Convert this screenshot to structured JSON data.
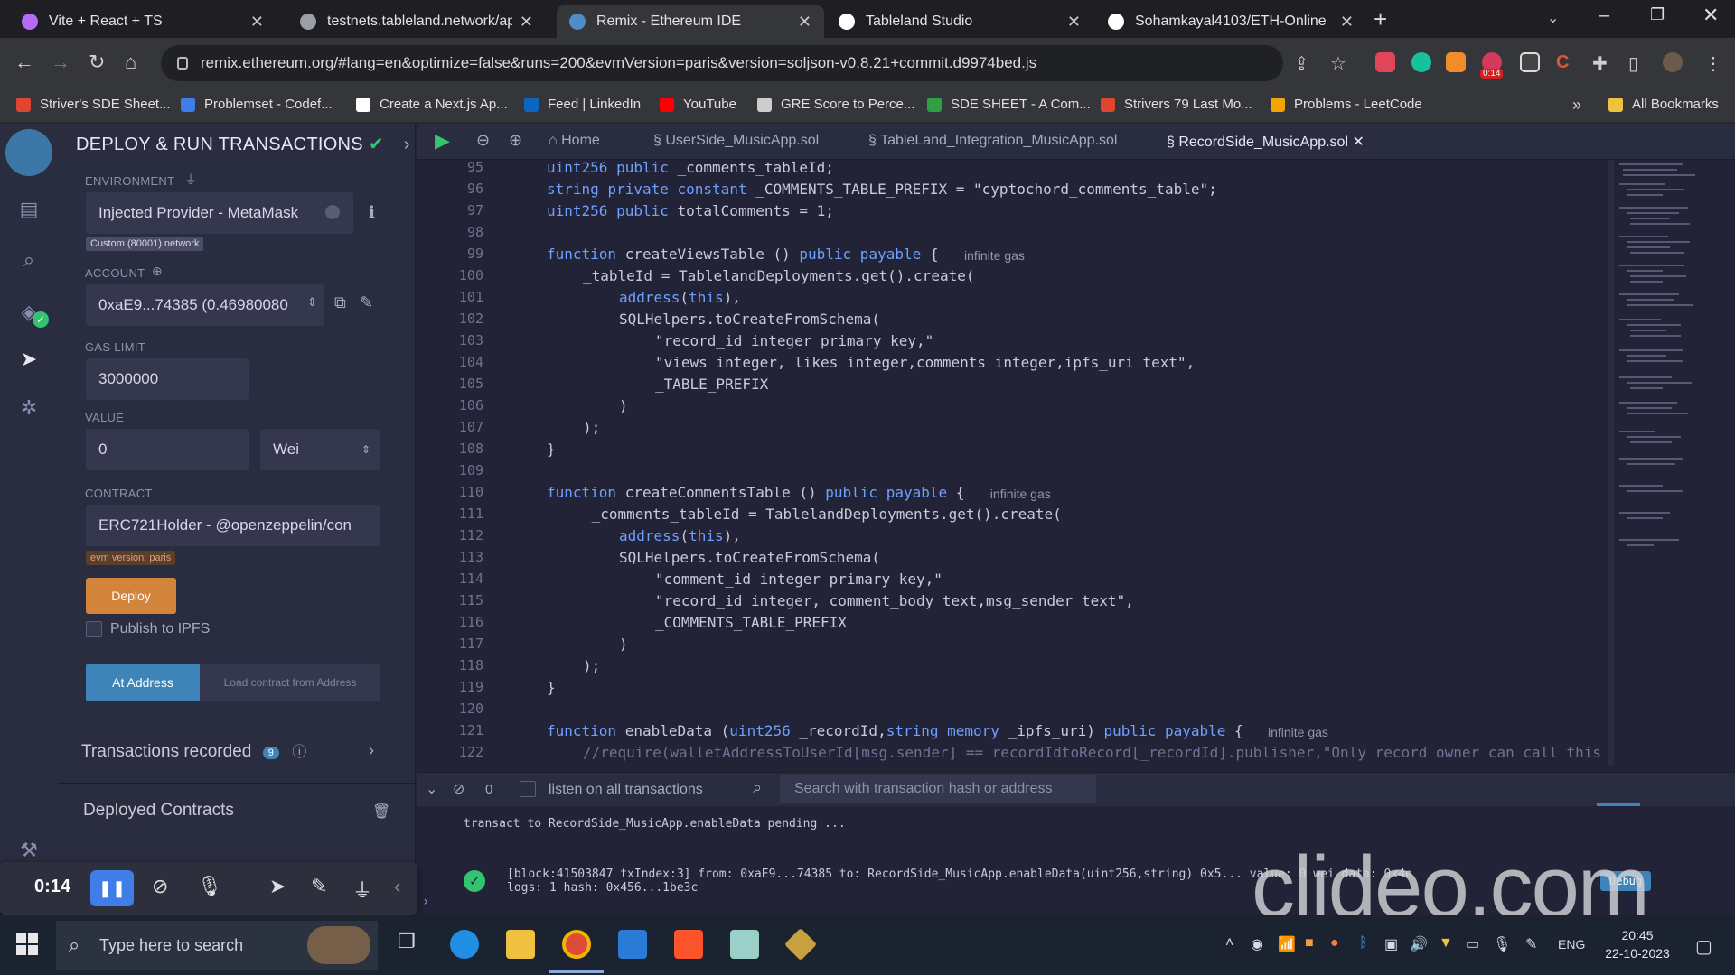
{
  "browser": {
    "tabs": [
      {
        "title": "Vite + React + TS",
        "active": false,
        "icon": "vite-icon",
        "color": "#b46cf7"
      },
      {
        "title": "testnets.tableland.network/api/v",
        "active": false,
        "icon": "globe-icon",
        "color": "#9aa0a6"
      },
      {
        "title": "Remix - Ethereum IDE",
        "active": true,
        "icon": "remix-icon",
        "color": "#4d8ec7"
      },
      {
        "title": "Tableland Studio",
        "active": false,
        "icon": "tableland-icon",
        "color": "#ffffff"
      },
      {
        "title": "Sohamkayal4103/ETH-Online",
        "active": false,
        "icon": "github-icon",
        "color": "#ffffff"
      }
    ],
    "new_tab": "+",
    "url": "remix.ethereum.org/#lang=en&optimize=false&runs=200&evmVersion=paris&version=soljson-v0.8.21+commit.d9974bed.js",
    "ext_badge": "0:14",
    "bookmarks": [
      {
        "label": "Striver's SDE Sheet...",
        "color": "#e0452f"
      },
      {
        "label": "Problemset - Codef...",
        "color": "#3f7ee8"
      },
      {
        "label": "Create a Next.js Ap...",
        "color": "#ffffff"
      },
      {
        "label": "Feed | LinkedIn",
        "color": "#0a66c2"
      },
      {
        "label": "YouTube",
        "color": "#ff0000"
      },
      {
        "label": "GRE Score to Perce...",
        "color": "#cccccc"
      },
      {
        "label": "SDE SHEET - A Com...",
        "color": "#2ea043"
      },
      {
        "label": "Strivers 79 Last Mo...",
        "color": "#e0452f"
      },
      {
        "label": "Problems - LeetCode",
        "color": "#f0a500"
      }
    ],
    "all_bookmarks": "All Bookmarks",
    "more": "»"
  },
  "remix": {
    "panel_title": "DEPLOY & RUN TRANSACTIONS",
    "environment_label": "ENVIRONMENT",
    "environment_value": "Injected Provider - MetaMask",
    "network_badge": "Custom (80001) network",
    "account_label": "ACCOUNT",
    "account_value": "0xaE9...74385 (0.46980080",
    "gas_limit_label": "GAS LIMIT",
    "gas_limit_value": "3000000",
    "value_label": "VALUE",
    "value_value": "0",
    "value_unit": "Wei",
    "contract_label": "CONTRACT",
    "contract_value": "ERC721Holder - @openzeppelin/con",
    "evm_badge": "evm version: paris",
    "deploy_button": "Deploy",
    "publish_ipfs": "Publish to IPFS",
    "at_address_button": "At Address",
    "load_contract": "Load contract from Address",
    "transactions_recorded": "Transactions recorded",
    "transactions_count": "9",
    "deployed_contracts": "Deployed Contracts"
  },
  "editor": {
    "tabs": [
      {
        "label": "Home",
        "active": false
      },
      {
        "label": "UserSide_MusicApp.sol",
        "active": false
      },
      {
        "label": "TableLand_Integration_MusicApp.sol",
        "active": false
      },
      {
        "label": "RecordSide_MusicApp.sol",
        "active": true
      }
    ],
    "lines": [
      {
        "n": "95",
        "indent": 0,
        "text": "uint256 public _comments_tableId;",
        "hint": ""
      },
      {
        "n": "96",
        "indent": 0,
        "text": "string private constant _COMMENTS_TABLE_PREFIX = \"cyptochord_comments_table\";",
        "hint": ""
      },
      {
        "n": "97",
        "indent": 0,
        "text": "uint256 public totalComments = 1;",
        "hint": ""
      },
      {
        "n": "98",
        "indent": 0,
        "text": "",
        "hint": ""
      },
      {
        "n": "99",
        "indent": 0,
        "text": "function createViewsTable () public payable {",
        "hint": "infinite gas"
      },
      {
        "n": "100",
        "indent": 1,
        "text": "_tableId = TablelandDeployments.get().create(",
        "hint": ""
      },
      {
        "n": "101",
        "indent": 2,
        "text": "address(this),",
        "hint": ""
      },
      {
        "n": "102",
        "indent": 2,
        "text": "SQLHelpers.toCreateFromSchema(",
        "hint": ""
      },
      {
        "n": "103",
        "indent": 3,
        "text": "\"record_id integer primary key,\"",
        "hint": ""
      },
      {
        "n": "104",
        "indent": 3,
        "text": "\"views integer, likes integer,comments integer,ipfs_uri text\",",
        "hint": ""
      },
      {
        "n": "105",
        "indent": 3,
        "text": "_TABLE_PREFIX",
        "hint": ""
      },
      {
        "n": "106",
        "indent": 2,
        "text": ")",
        "hint": ""
      },
      {
        "n": "107",
        "indent": 1,
        "text": ");",
        "hint": ""
      },
      {
        "n": "108",
        "indent": 0,
        "text": "}",
        "hint": ""
      },
      {
        "n": "109",
        "indent": 0,
        "text": "",
        "hint": ""
      },
      {
        "n": "110",
        "indent": 0,
        "text": "function createCommentsTable () public payable {",
        "hint": "infinite gas"
      },
      {
        "n": "111",
        "indent": 1,
        "text": " _comments_tableId = TablelandDeployments.get().create(",
        "hint": ""
      },
      {
        "n": "112",
        "indent": 2,
        "text": "address(this),",
        "hint": ""
      },
      {
        "n": "113",
        "indent": 2,
        "text": "SQLHelpers.toCreateFromSchema(",
        "hint": ""
      },
      {
        "n": "114",
        "indent": 3,
        "text": "\"comment_id integer primary key,\"",
        "hint": ""
      },
      {
        "n": "115",
        "indent": 3,
        "text": "\"record_id integer, comment_body text,msg_sender text\",",
        "hint": ""
      },
      {
        "n": "116",
        "indent": 3,
        "text": "_COMMENTS_TABLE_PREFIX",
        "hint": ""
      },
      {
        "n": "117",
        "indent": 2,
        "text": ")",
        "hint": ""
      },
      {
        "n": "118",
        "indent": 1,
        "text": ");",
        "hint": ""
      },
      {
        "n": "119",
        "indent": 0,
        "text": "}",
        "hint": ""
      },
      {
        "n": "120",
        "indent": 0,
        "text": "",
        "hint": ""
      },
      {
        "n": "121",
        "indent": 0,
        "text": "function enableData (uint256 _recordId,string memory _ipfs_uri) public payable {",
        "hint": "infinite gas"
      },
      {
        "n": "122",
        "indent": 1,
        "text": "//require(walletAddressToUserId[msg.sender] == recordIdtoRecord[_recordId].publisher,\"Only record owner can call this",
        "hint": ""
      }
    ]
  },
  "terminal": {
    "count": "0",
    "listen_label": "listen on all transactions",
    "search_placeholder": "Search with transaction hash or address",
    "pending": "transact to RecordSide_MusicApp.enableData pending ...",
    "tx_line1": "[block:41503847 txIndex:3]  from: 0xaE9...74385 to: RecordSide_MusicApp.enableData(uint256,string) 0x5... value: 0 wei data: 0x4e... logs: 0",
    "tx_line2": "logs: 1 hash: 0x456...1be3c",
    "debug": "Debug"
  },
  "recorder": {
    "time": "0:14"
  },
  "watermark": "clideo.com",
  "taskbar": {
    "search_placeholder": "Type here to search",
    "lang": "ENG",
    "time": "20:45",
    "date": "22-10-2023"
  },
  "colors": {
    "accent_green": "#32c470",
    "deploy_orange": "#d2843b",
    "at_address_blue": "#3f84b8",
    "string_color": "#c9cbd8",
    "keyword_color": "#6ea0ff"
  }
}
